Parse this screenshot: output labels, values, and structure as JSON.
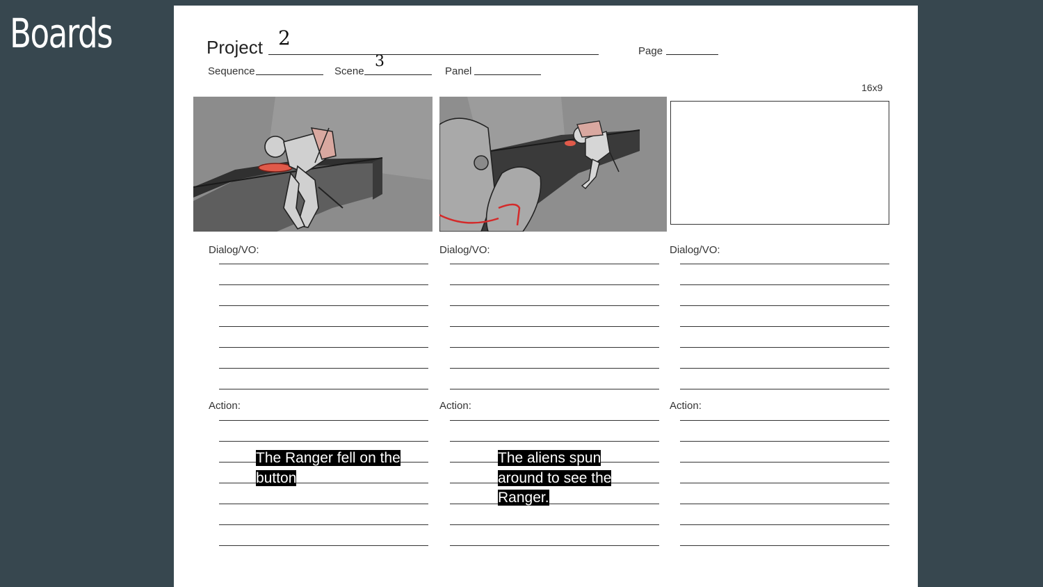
{
  "slide": {
    "title": "Boards"
  },
  "header": {
    "project_label": "Project",
    "project_value": "2",
    "page_label": "Page",
    "sequence_label": "Sequence",
    "scene_label": "Scene",
    "scene_value": "3",
    "panel_label": "Panel",
    "aspect_ratio": "16x9"
  },
  "columns": [
    {
      "dialog_label": "Dialog/VO:",
      "action_label": "Action:",
      "action_note": [
        "The Ranger fell on the",
        "button"
      ]
    },
    {
      "dialog_label": "Dialog/VO:",
      "action_label": "Action:",
      "action_note": [
        "The aliens spun",
        "around to see the",
        "Ranger."
      ]
    },
    {
      "dialog_label": "Dialog/VO:",
      "action_label": "Action:",
      "action_note": []
    }
  ],
  "colors": {
    "background": "#37474f",
    "sheet": "#ffffff",
    "highlight": "#000000"
  }
}
